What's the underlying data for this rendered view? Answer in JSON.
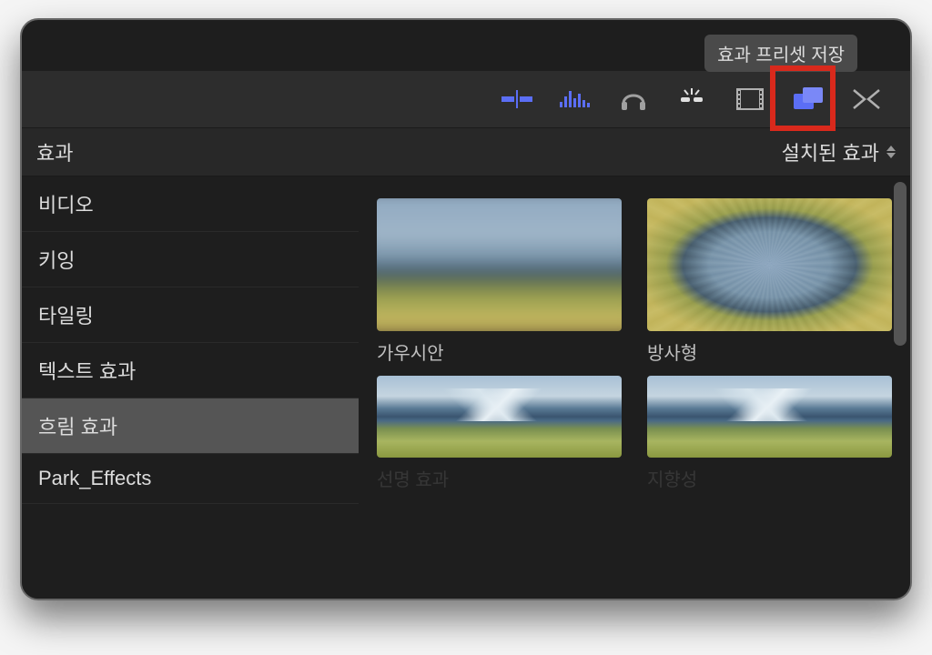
{
  "tooltip": "효과 프리셋 저장",
  "header": {
    "title": "효과",
    "filter": "설치된 효과"
  },
  "sidebar": {
    "items": [
      {
        "label": "비디오",
        "selected": false
      },
      {
        "label": "키잉",
        "selected": false
      },
      {
        "label": "타일링",
        "selected": false
      },
      {
        "label": "텍스트 효과",
        "selected": false
      },
      {
        "label": "흐림 효과",
        "selected": true
      },
      {
        "label": "Park_Effects",
        "selected": false
      }
    ]
  },
  "effects": [
    {
      "label": "가우시안",
      "preview": "gaussian"
    },
    {
      "label": "방사형",
      "preview": "radial"
    },
    {
      "label": "선명 효과",
      "preview": "mountains"
    },
    {
      "label": "지향성",
      "preview": "mountains"
    }
  ],
  "toolbar": {
    "icons": [
      "color-balance-icon",
      "audio-levels-icon",
      "headphones-icon",
      "light-burst-icon",
      "film-frames-icon",
      "effects-browser-icon",
      "transitions-icon"
    ]
  },
  "colors": {
    "accent": "#5b6ef5",
    "highlight": "#d9291c"
  }
}
